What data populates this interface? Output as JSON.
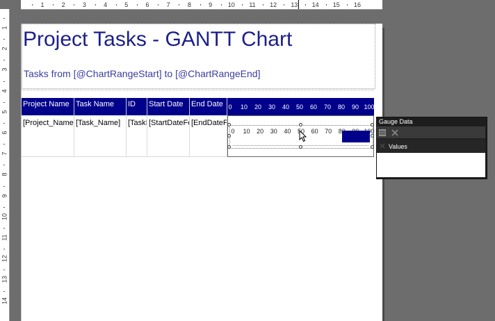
{
  "ruler": {
    "horizontal": [
      "1",
      "2",
      "3",
      "4",
      "5",
      "6",
      "7",
      "8",
      "9",
      "10",
      "11",
      "12",
      "13",
      "14",
      "15",
      "16"
    ],
    "vertical": [
      "1",
      "2",
      "3",
      "4",
      "5",
      "6",
      "7",
      "8",
      "9",
      "10",
      "11",
      "12",
      "13",
      "14"
    ]
  },
  "report": {
    "title": "Project Tasks - GANTT Chart",
    "subtitle": "Tasks from [@ChartRangeStart] to [@ChartRangeEnd]"
  },
  "table": {
    "headers": [
      "Project Name",
      "Task Name",
      "ID",
      "Start Date",
      "End Date"
    ],
    "cells": [
      "[Project_Name]",
      "[Task_Name]",
      "[TaskI",
      "[StartDateFo",
      "[EndDateFo"
    ],
    "scale": [
      "0",
      "10",
      "20",
      "30",
      "40",
      "50",
      "60",
      "70",
      "80",
      "90",
      "100"
    ]
  },
  "gauge": {
    "scale": [
      "0",
      "10",
      "20",
      "30",
      "40",
      "50",
      "60",
      "70",
      "80",
      "90",
      "100"
    ]
  },
  "gauge_pane": {
    "title": "Gauge Data",
    "section": "Values"
  },
  "colors": {
    "header_bg": "#00008b",
    "title_color": "#1b1f8a",
    "pane_bg": "#1e1e1e"
  }
}
